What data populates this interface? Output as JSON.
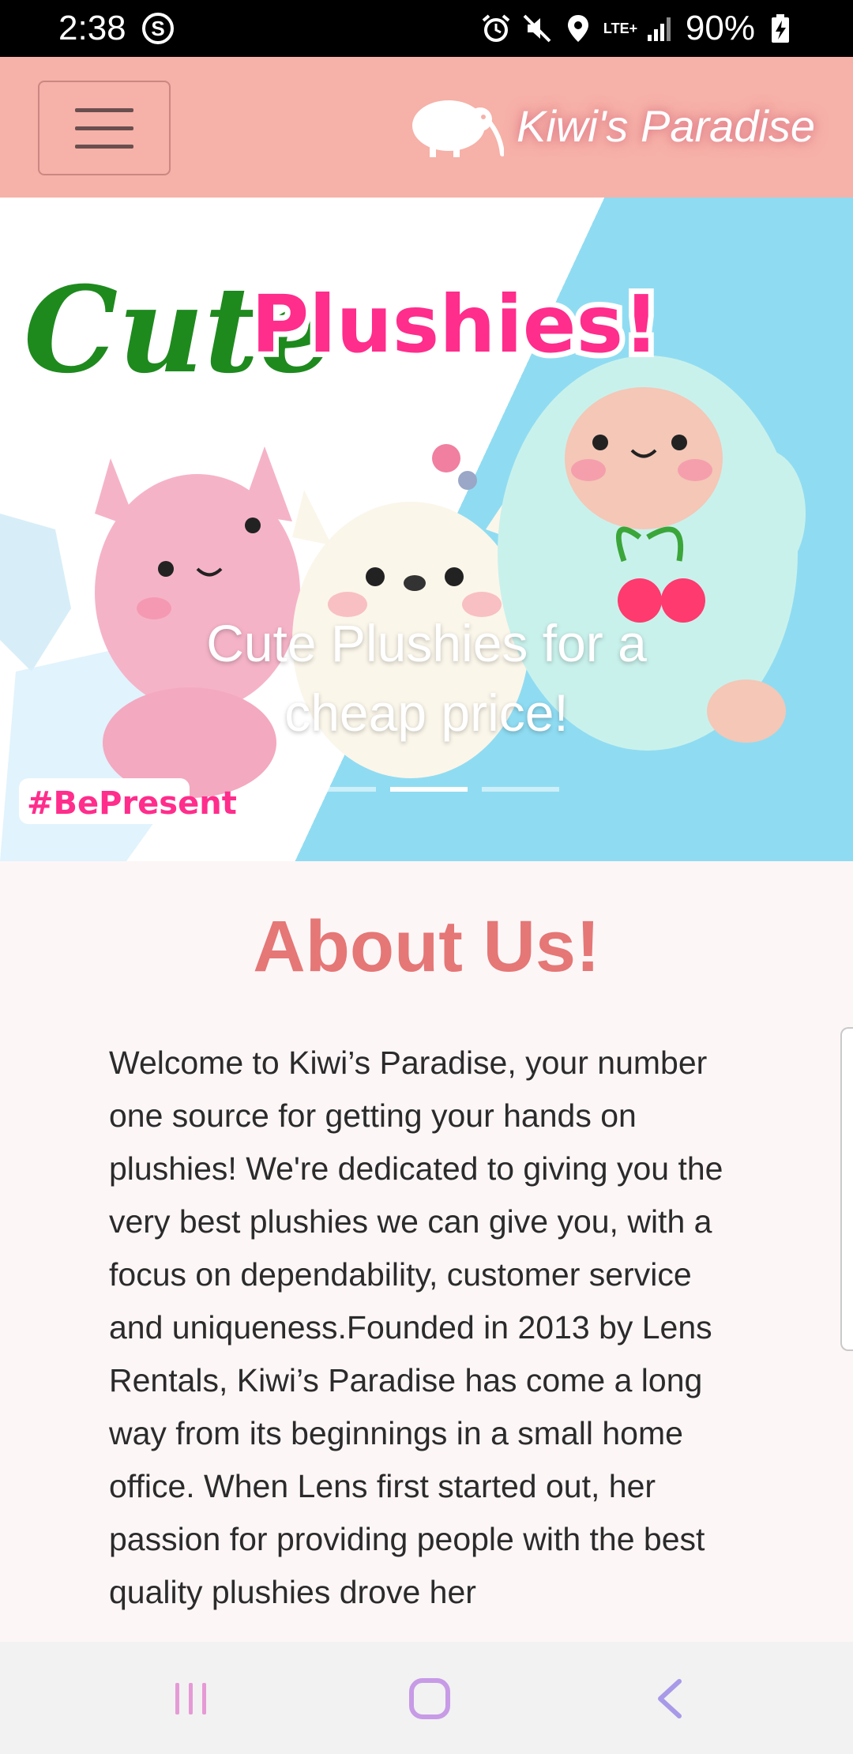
{
  "status_bar": {
    "time": "2:38",
    "app_icon": "S",
    "network": "LTE+",
    "battery": "90%"
  },
  "navbar": {
    "brand_name": "Kiwi's Paradise",
    "menu_icon": "hamburger-icon"
  },
  "hero": {
    "banner_title_word1": "Cute",
    "banner_title_word2": "Plushies!",
    "banner_hashtag": "#BePresent",
    "caption": "Cute Plushies for a cheap price!",
    "slides": 3,
    "active_slide": 2
  },
  "about": {
    "title": "About Us!",
    "body": "Welcome to Kiwi’s Paradise, your number one source for getting your hands on plushies! We're dedicated to giving you the very best plushies we can give you, with a focus on dependability, customer service and uniqueness.Founded in 2013 by Lens Rentals, Kiwi’s Paradise has come a long way from its beginnings in a small home office. When Lens first started out, her passion for providing people with the best quality plushies drove her"
  },
  "colors": {
    "navbar": "#f6b1a8",
    "title_accent": "#e57776",
    "banner_green": "#1e8a1e",
    "banner_pink": "#ff2d8c",
    "banner_sky": "#8fdcf2"
  },
  "system_nav": {
    "recents_icon": "recents-icon",
    "home_icon": "home-icon",
    "back_icon": "back-icon"
  }
}
